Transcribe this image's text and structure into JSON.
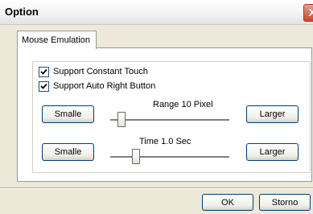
{
  "window": {
    "title": "Option",
    "close_glyph": "X"
  },
  "tabs": [
    {
      "label": "Mouse Emulation",
      "selected": true
    }
  ],
  "checkboxes": [
    {
      "label": "Support Constant Touch",
      "checked": true
    },
    {
      "label": "Support Auto Right Button",
      "checked": true
    }
  ],
  "range": {
    "caption": "Range   10   Pixel",
    "smaller_label": "Smalle",
    "larger_label": "Larger",
    "value": 10,
    "unit": "Pixel"
  },
  "time": {
    "caption": "Time   1.0   Sec",
    "smaller_label": "Smalle",
    "larger_label": "Larger",
    "value": 1.0,
    "unit": "Sec"
  },
  "buttons": {
    "ok": "OK",
    "cancel": "Storno"
  }
}
